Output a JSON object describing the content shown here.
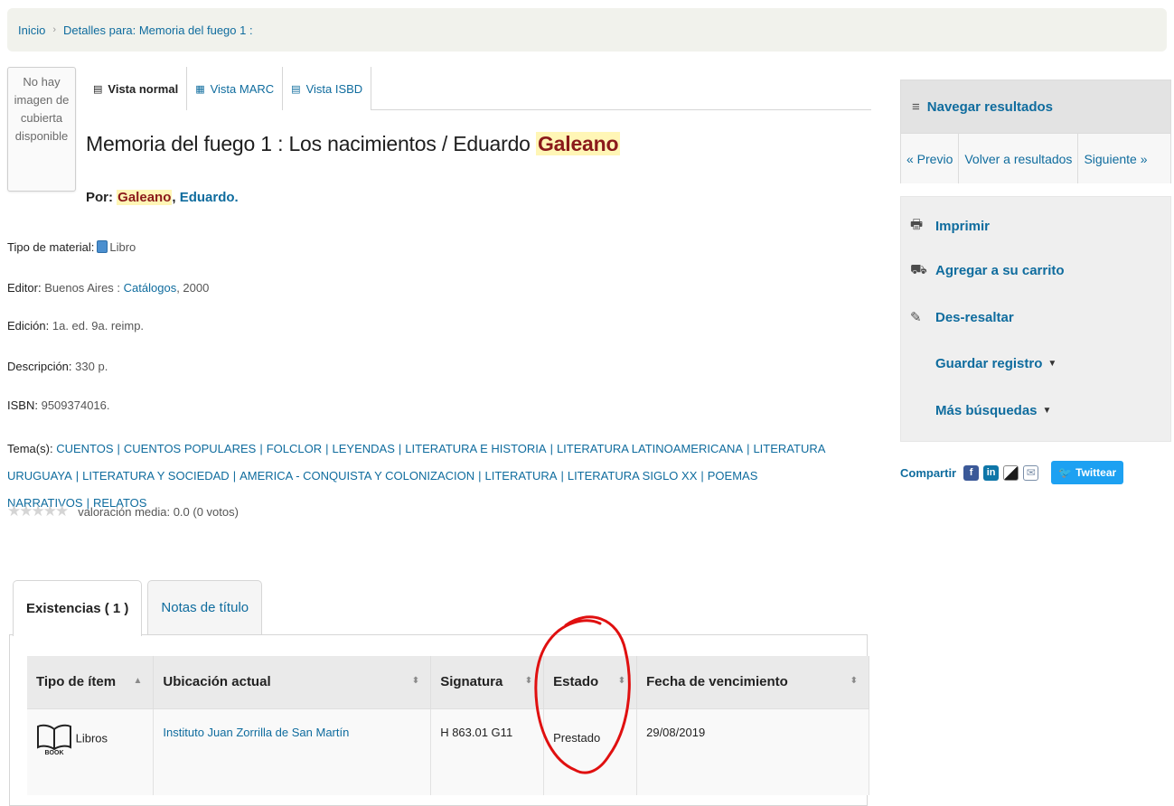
{
  "breadcrumb": {
    "home": "Inicio",
    "sep": "›",
    "current": "Detalles para: Memoria del fuego 1 :"
  },
  "cover": {
    "lines": [
      "No hay",
      "imagen de",
      "cubierta",
      "disponible"
    ]
  },
  "view_tabs": [
    {
      "label": "Vista normal",
      "icon": "document-icon"
    },
    {
      "label": "Vista MARC",
      "icon": "list-icon"
    },
    {
      "label": "Vista ISBD",
      "icon": "isbd-icon"
    }
  ],
  "record": {
    "title_main": "Memoria del fuego 1 : Los nacimientos / Eduardo ",
    "title_highlight": "Galeano",
    "author_prefix": "Por:",
    "author_last": "Galeano",
    "author_comma": ",",
    "author_first": "Eduardo.",
    "material_label": "Tipo de material:",
    "material_value": "Libro",
    "editor_label": "Editor:",
    "editor_place": "Buenos Aires :",
    "editor_publisher": "Catálogos",
    "editor_year": ", 2000",
    "edition_label": "Edición:",
    "edition_value": "1a. ed. 9a. reimp.",
    "description_label": "Descripción:",
    "description_value": "330 p.",
    "isbn_label": "ISBN:",
    "isbn_value": "9509374016.",
    "subjects_label": "Tema(s):",
    "subjects": [
      "CUENTOS",
      "CUENTOS POPULARES",
      "FOLCLOR",
      "LEYENDAS",
      "LITERATURA E HISTORIA",
      "LITERATURA LATINOAMERICANA",
      "LITERATURA URUGUAYA",
      "LITERATURA Y SOCIEDAD",
      "AMERICA - CONQUISTA Y COLONIZACION",
      "LITERATURA",
      "LITERATURA SIGLO XX",
      "POEMAS NARRATIVOS",
      "RELATOS"
    ],
    "rating_text": "valoración media: 0.0 (0 votos)",
    "rating_value": 0
  },
  "browse": {
    "title": "Navegar resultados",
    "prev": "« Previo",
    "back": "Volver a resultados",
    "next": "Siguiente »"
  },
  "actions": {
    "print": "Imprimir",
    "cart": "Agregar a su carrito",
    "unhighlight": "Des-resaltar",
    "save": "Guardar registro",
    "more": "Más búsquedas"
  },
  "share": {
    "label": "Compartir",
    "tweet": "Twittear"
  },
  "holdings_tabs": {
    "holdings": "Existencias ( 1 )",
    "notes": "Notas de título"
  },
  "holdings_table": {
    "headers": [
      "Tipo de ítem",
      "Ubicación actual",
      "Signatura",
      "Estado",
      "Fecha de vencimiento"
    ],
    "rows": [
      {
        "item_type": "Libros",
        "item_icon_text": "BOOK",
        "location": "Instituto Juan Zorrilla de San Martín",
        "call_number": "H 863.01 G11",
        "status": "Prestado",
        "due_date": "29/08/2019"
      }
    ]
  },
  "colors": {
    "link": "#0f6c9e",
    "highlight_bg": "#fff6b6",
    "highlight_text": "#8b1a1a",
    "annotation": "#e01010"
  }
}
